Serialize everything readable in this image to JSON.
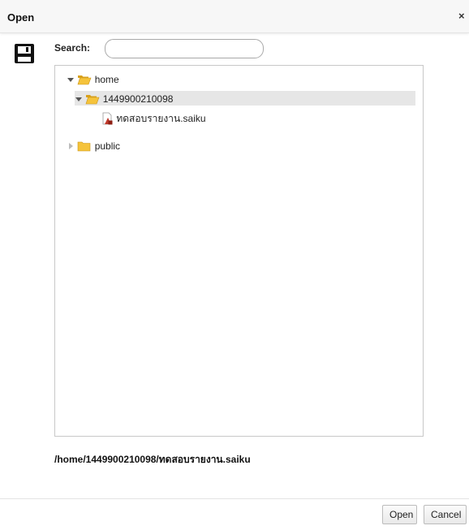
{
  "dialog": {
    "title": "Open",
    "close_glyph": "×"
  },
  "search": {
    "label": "Search:",
    "value": "",
    "placeholder": ""
  },
  "tree": {
    "nodes": [
      {
        "label": "home",
        "type": "folder",
        "state": "expanded"
      },
      {
        "label": "1449900210098",
        "type": "folder",
        "state": "expanded",
        "selected": true
      },
      {
        "label": "ทดสอบรายงาน.saiku",
        "type": "file"
      },
      {
        "label": "public",
        "type": "folder",
        "state": "collapsed"
      }
    ]
  },
  "selected_path": "/home/1449900210098/ทดสอบรายงาน.saiku",
  "buttons": {
    "open": "Open",
    "cancel": "Cancel"
  },
  "icons": {
    "dialog": "floppy-disk-icon",
    "folder_color": "#f5c33b",
    "file_accent": "#c0392b"
  }
}
